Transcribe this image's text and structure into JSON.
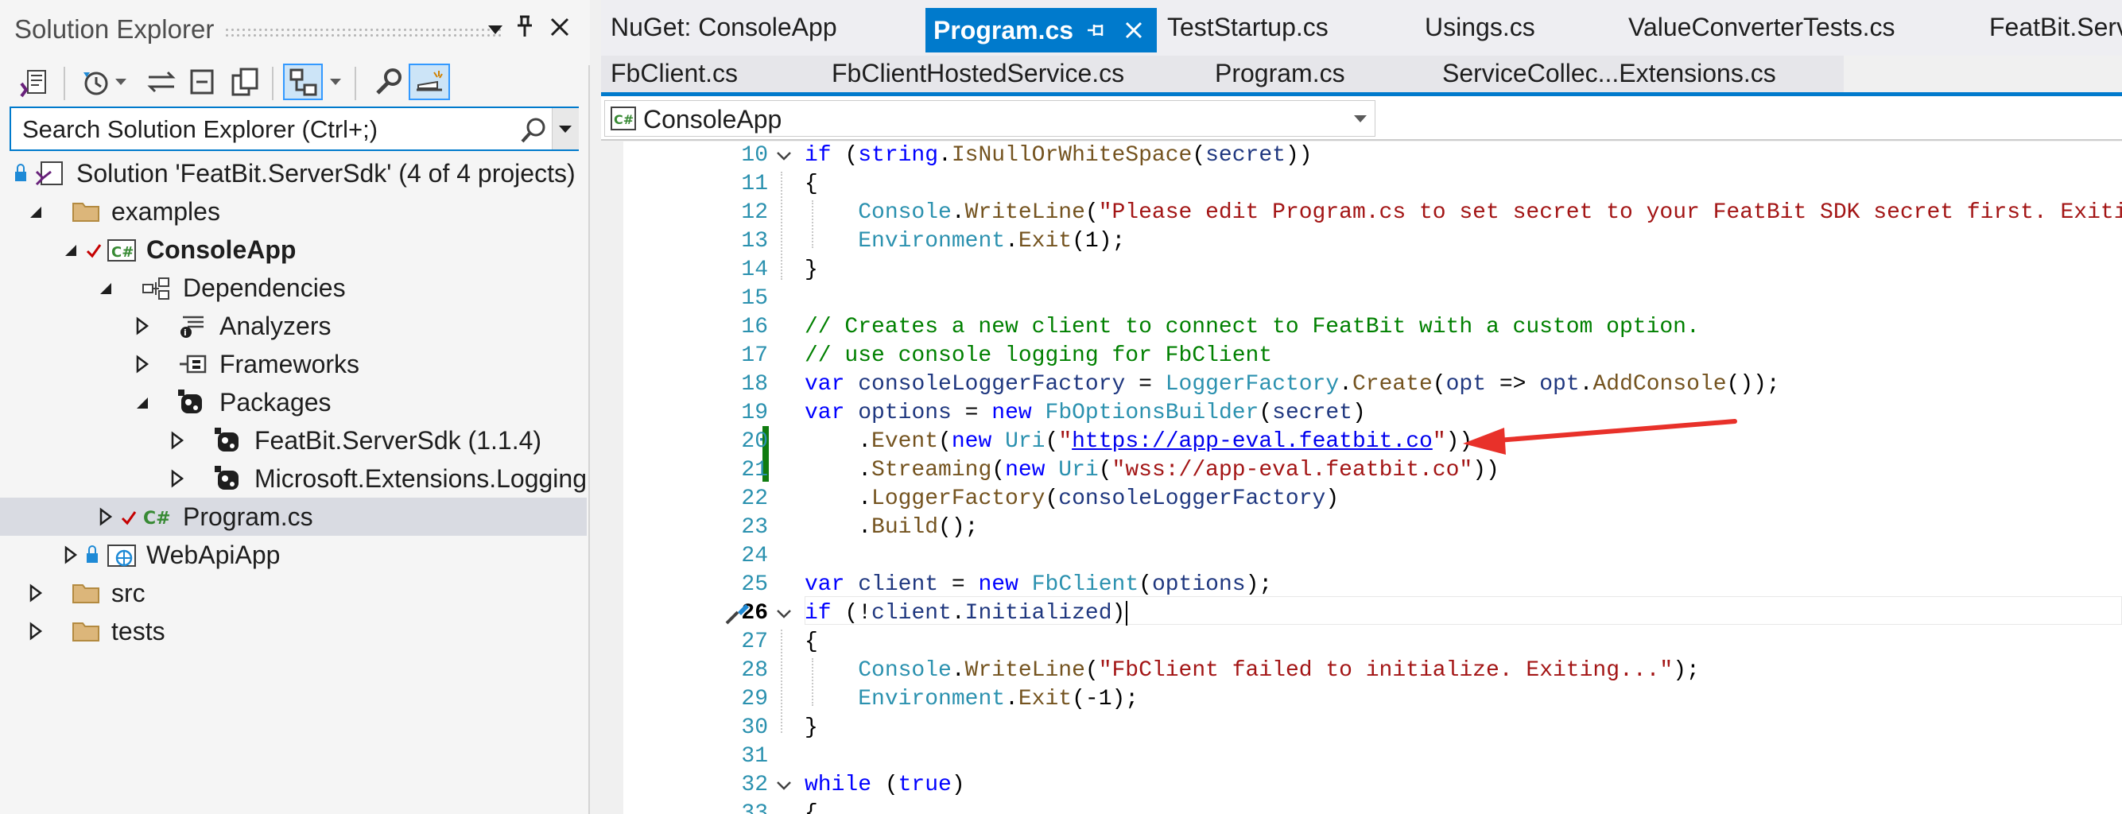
{
  "solution_explorer": {
    "title": "Solution Explorer",
    "search_placeholder": "Search Solution Explorer (Ctrl+;)",
    "tree": [
      {
        "label": "Solution 'FeatBit.ServerSdk' (4 of 4 projects)",
        "icon": "solution-icon"
      },
      {
        "label": "examples",
        "icon": "folder-icon"
      },
      {
        "label": "ConsoleApp",
        "icon": "csharp-project-icon",
        "bold": true
      },
      {
        "label": "Dependencies",
        "icon": "dependencies-icon"
      },
      {
        "label": "Analyzers",
        "icon": "analyzers-icon"
      },
      {
        "label": "Frameworks",
        "icon": "frameworks-icon"
      },
      {
        "label": "Packages",
        "icon": "packages-icon"
      },
      {
        "label": "FeatBit.ServerSdk (1.1.4)",
        "icon": "package-icon"
      },
      {
        "label": "Microsoft.Extensions.Logging",
        "icon": "package-icon"
      },
      {
        "label": "Program.cs",
        "icon": "csharp-file-icon",
        "selected": true
      },
      {
        "label": "WebApiApp",
        "icon": "web-project-icon"
      },
      {
        "label": "src",
        "icon": "folder-icon"
      },
      {
        "label": "tests",
        "icon": "folder-icon"
      }
    ]
  },
  "editor": {
    "tabs_row1": [
      "NuGet: ConsoleApp",
      "Program.cs",
      "TestStartup.cs",
      "Usings.cs",
      "ValueConverterTests.cs",
      "FeatBit.Serv"
    ],
    "tabs_row2": [
      "FbClient.cs",
      "FbClientHostedService.cs",
      "Program.cs",
      "ServiceCollec...Extensions.cs"
    ],
    "active_tab": "Program.cs",
    "project_selector": "ConsoleApp",
    "current_line": "26",
    "line_numbers": [
      "10",
      "11",
      "12",
      "13",
      "14",
      "15",
      "16",
      "17",
      "18",
      "19",
      "20",
      "21",
      "22",
      "23",
      "24",
      "25",
      "26",
      "27",
      "28",
      "29",
      "30",
      "31",
      "32",
      "33"
    ]
  },
  "colors": {
    "accent": "#007acc",
    "arrow": "#e8312a",
    "change_bar": "#107c10"
  }
}
